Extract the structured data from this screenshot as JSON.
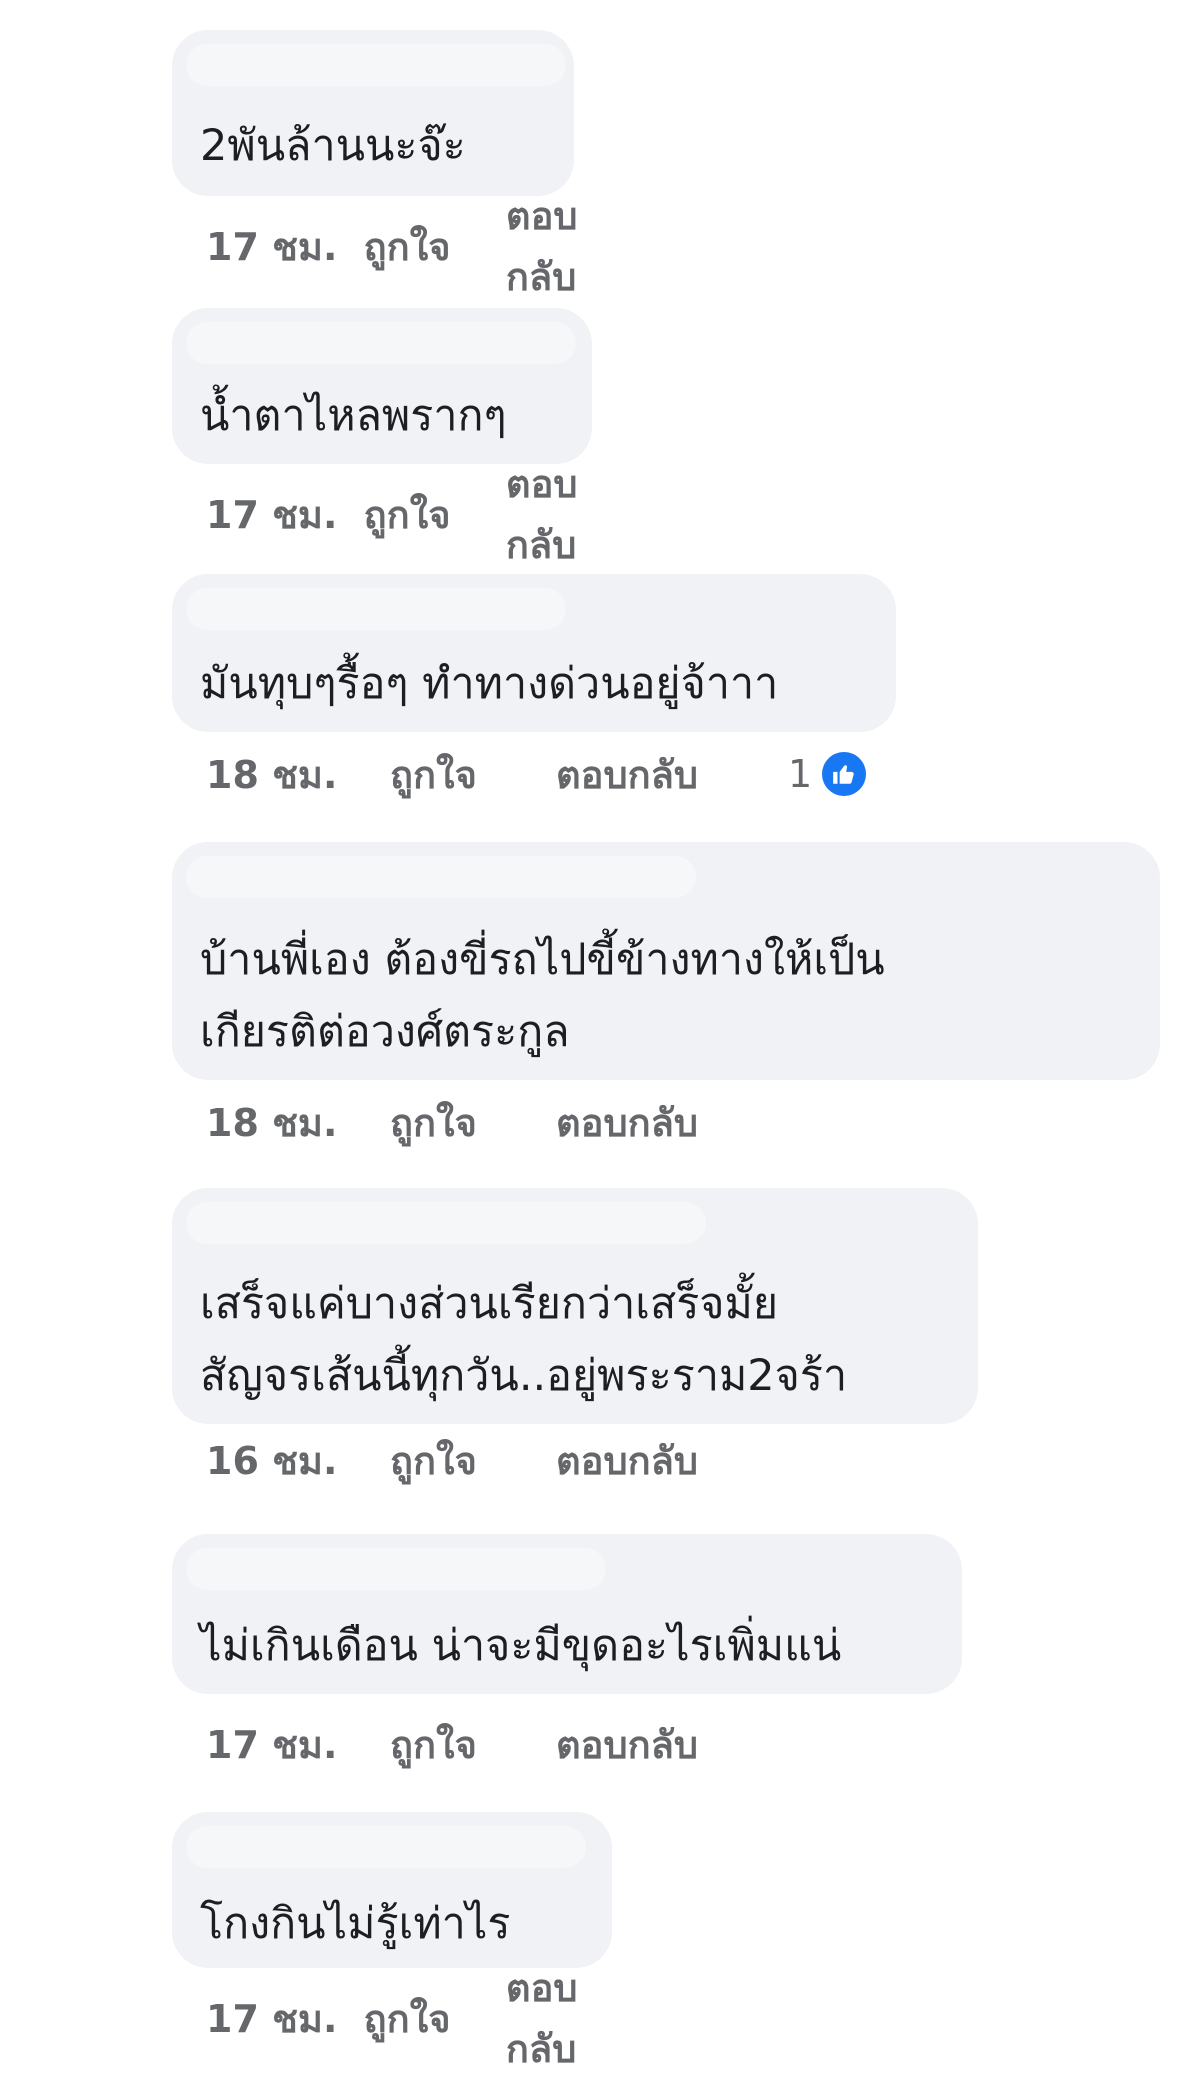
{
  "comments": [
    {
      "text": "2พันล้านนะจ๊ะ",
      "time": "17 ชม.",
      "like": "ถูกใจ",
      "reply": "ตอบกลับ"
    },
    {
      "text": "น้ำตาไหลพรากๆ",
      "time": "17 ชม.",
      "like": "ถูกใจ",
      "reply": "ตอบกลับ"
    },
    {
      "text": "มันทุบๆรื้อๆ ทำทางด่วนอยู่จ้าาา",
      "time": "18 ชม.",
      "like": "ถูกใจ",
      "reply": "ตอบกลับ",
      "reaction_count": "1"
    },
    {
      "text": "บ้านพี่เอง  ต้องขี่รถไปขี้ข้างทางให้เป็น\nเกียรติต่อวงศ์ตระกูล",
      "time": "18 ชม.",
      "like": "ถูกใจ",
      "reply": "ตอบกลับ"
    },
    {
      "text": "เสร็จแค่บางส่วนเรียกว่าเสร็จมั้ย\nสัญจรเส้นนี้ทุกวัน..อยู่พระราม2จร้า",
      "time": "16 ชม.",
      "like": "ถูกใจ",
      "reply": "ตอบกลับ"
    },
    {
      "text": "ไม่เกินเดือน น่าจะมีขุดอะไรเพิ่มแน่",
      "time": "17 ชม.",
      "like": "ถูกใจ",
      "reply": "ตอบกลับ"
    },
    {
      "text": "โกงกินไม่รู้เท่าไร",
      "time": "17 ชม.",
      "like": "ถูกใจ",
      "reply": "ตอบกลับ"
    }
  ],
  "colors": {
    "bubble": "#f0f2f5",
    "meta_text": "#65676b",
    "like_badge": "#1877f2"
  }
}
